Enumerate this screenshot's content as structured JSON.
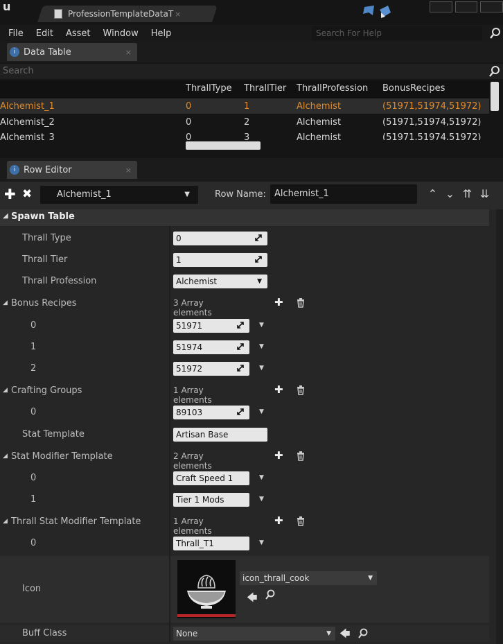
{
  "window": {
    "tab_title": "ProfessionTemplateDataT",
    "tab_close": "×"
  },
  "menu": [
    "File",
    "Edit",
    "Asset",
    "Window",
    "Help"
  ],
  "help_search": {
    "placeholder": "Search For Help"
  },
  "data_table_panel": {
    "title": "Data Table",
    "close": "×"
  },
  "table_search": {
    "placeholder": "Search"
  },
  "table": {
    "columns": [
      "",
      "ThrallType",
      "ThrallTier",
      "ThrallProfession",
      "BonusRecipes"
    ],
    "rows": [
      [
        "Alchemist_1",
        "0",
        "1",
        "Alchemist",
        "(51971,51974,51972)"
      ],
      [
        "Alchemist_2",
        "0",
        "2",
        "Alchemist",
        "(51971,51974,51972)"
      ],
      [
        "Alchemist_3",
        "0",
        "3",
        "Alchemist",
        "(51971,51974,51972)"
      ]
    ],
    "selected_row": 0,
    "highlight_color": "#e08a2a"
  },
  "row_editor_panel": {
    "title": "Row Editor",
    "close": "×"
  },
  "toolbar": {
    "add": "✚",
    "remove": "✖",
    "row_select": "Alchemist_1",
    "row_name_label": "Row Name:",
    "row_name_value": "Alchemist_1"
  },
  "details": {
    "category": "Spawn Table",
    "thrall_type": {
      "label": "Thrall Type",
      "value": "0"
    },
    "thrall_tier": {
      "label": "Thrall Tier",
      "value": "1"
    },
    "thrall_profession": {
      "label": "Thrall Profession",
      "value": "Alchemist"
    },
    "bonus_recipes": {
      "label": "Bonus Recipes",
      "count_text": "3 Array elements",
      "items": [
        {
          "index": "0",
          "value": "51971"
        },
        {
          "index": "1",
          "value": "51974"
        },
        {
          "index": "2",
          "value": "51972"
        }
      ]
    },
    "crafting_groups": {
      "label": "Crafting Groups",
      "count_text": "1 Array elements",
      "items": [
        {
          "index": "0",
          "value": "89103"
        }
      ]
    },
    "stat_template": {
      "label": "Stat Template",
      "value": "Artisan Base"
    },
    "stat_modifier_template": {
      "label": "Stat Modifier Template",
      "count_text": "2 Array elements",
      "items": [
        {
          "index": "0",
          "value": "Craft Speed 1"
        },
        {
          "index": "1",
          "value": "Tier 1 Mods"
        }
      ]
    },
    "thrall_stat_modifier_template": {
      "label": "Thrall Stat Modifier Template",
      "count_text": "1 Array elements",
      "items": [
        {
          "index": "0",
          "value": "Thrall_T1"
        }
      ]
    },
    "icon": {
      "label": "Icon",
      "asset": "icon_thrall_cook"
    },
    "buff_class": {
      "label": "Buff Class",
      "value": "None"
    }
  }
}
